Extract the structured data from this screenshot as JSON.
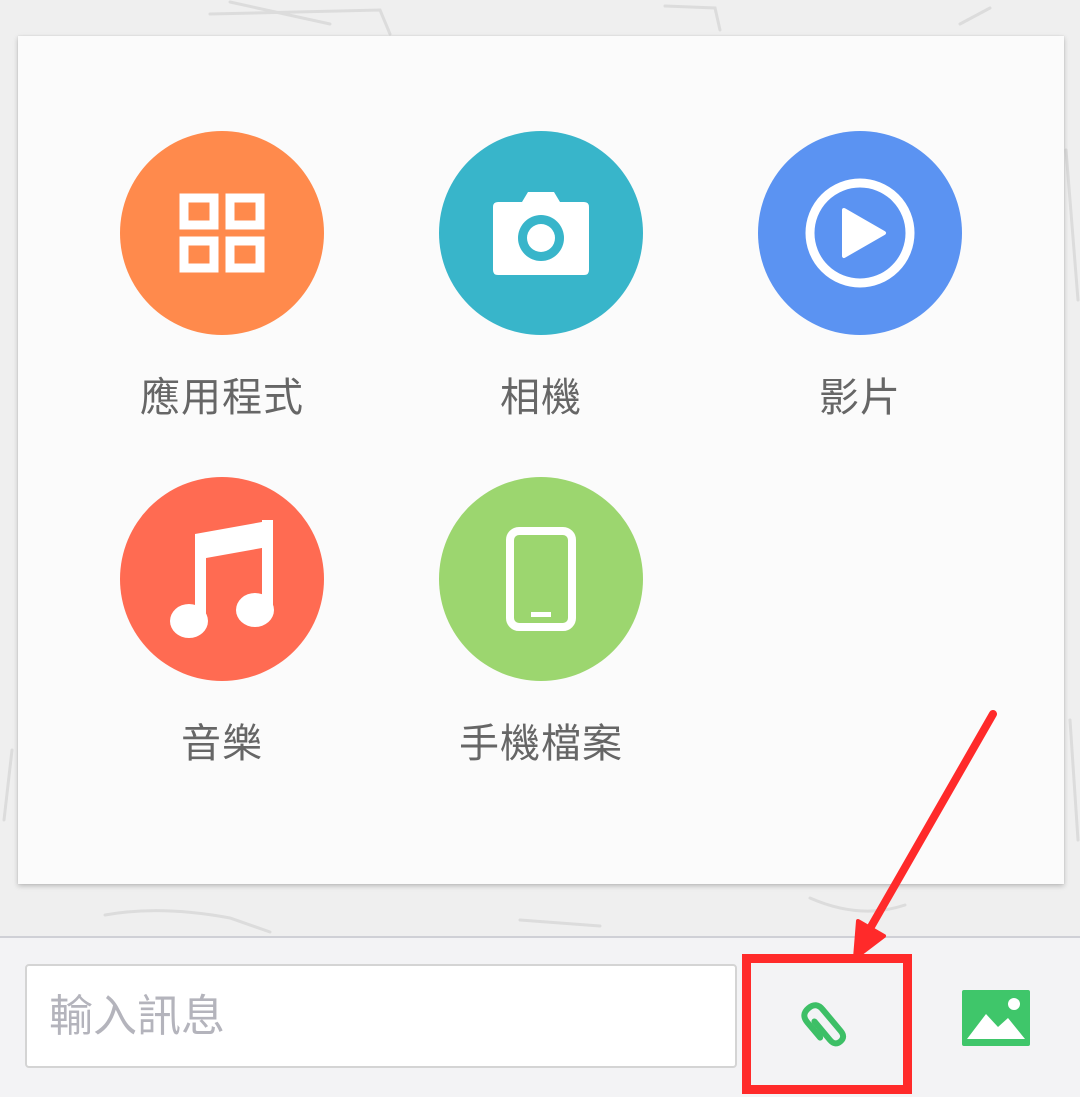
{
  "colors": {
    "apps": "#ff8a4c",
    "camera": "#38b5ca",
    "video": "#5b93f2",
    "music": "#ff6b52",
    "phone_files": "#9cd66f",
    "attach_green": "#3dbf66",
    "highlight_red": "#ff2a2a"
  },
  "menu": {
    "items": [
      {
        "label": "應用程式",
        "icon": "grid-icon"
      },
      {
        "label": "相機",
        "icon": "camera-icon"
      },
      {
        "label": "影片",
        "icon": "play-icon"
      },
      {
        "label": "音樂",
        "icon": "music-note-icon"
      },
      {
        "label": "手機檔案",
        "icon": "smartphone-icon"
      }
    ]
  },
  "composer": {
    "placeholder": "輸入訊息",
    "value": "",
    "attach_icon": "paperclip-icon",
    "image_icon": "image-icon"
  }
}
